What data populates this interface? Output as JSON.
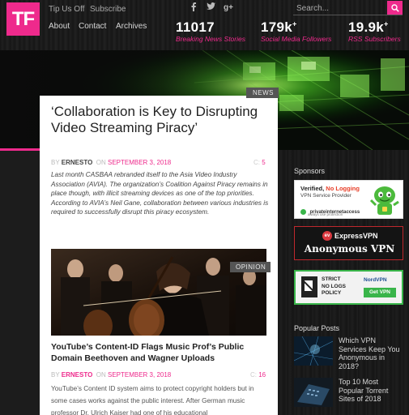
{
  "header": {
    "logo_text": "TF",
    "top_links": [
      "Tip Us Off",
      "Subscribe"
    ],
    "nav": [
      "About",
      "Contact",
      "Archives"
    ],
    "social_icons": [
      "facebook-icon",
      "twitter-icon",
      "google-plus-icon"
    ],
    "search_placeholder": "Search...",
    "stats": [
      {
        "number": "11017",
        "sup": "",
        "label": "Breaking News Stories"
      },
      {
        "number": "179k",
        "sup": "+",
        "label": "Social Media Followers"
      },
      {
        "number": "19.9k",
        "sup": "+",
        "label": "RSS Subscribers"
      }
    ],
    "accent_color": "#ee2a8c"
  },
  "feature": {
    "tag": "NEWS",
    "title": "‘Collaboration is Key to Disrupting Video Streaming Piracy’",
    "by_prefix": "BY",
    "author": "ERNESTO",
    "on_prefix": "ON",
    "date": "SEPTEMBER 3, 2018",
    "comment_prefix": "C:",
    "comments": "5",
    "excerpt": "Last month CASBAA rebranded itself to the Asia Video Industry Association (AVIA). The organization’s Coalition Against Piracy remains in place though, with illicit streaming devices as one of the top priorities. According to AVIA’s Neil Gane, collaboration between various industries is required to successfully disrupt this piracy ecosystem."
  },
  "second": {
    "tag": "OPINION",
    "title": "YouTube’s Content-ID Flags Music Prof’s Public Domain Beethoven and Wagner Uploads",
    "by_prefix": "BY",
    "author": "ERNESTO",
    "on_prefix": "ON",
    "date": "SEPTEMBER 3, 2018",
    "comment_prefix": "C:",
    "comments": "16",
    "excerpt": "YouTube’s Content ID system aims to protect copyright holders but in some cases works against the public interest. After German music professor Dr. Ulrich Kaiser had one of his educational"
  },
  "sidebar": {
    "sponsors_heading": "Sponsors",
    "ad1": {
      "line1": "Verified,",
      "line1_highlight": "No Logging",
      "line2": "VPN Service Provider",
      "brand": "privateinternetaccess",
      "brand_sub": "always use protection"
    },
    "ad2": {
      "brand": "ExpressVPN",
      "tagline": "Anonymous VPN"
    },
    "ad3": {
      "lines": [
        "STRICT",
        "NO LOGS",
        "POLICY"
      ],
      "brand": "NordVPN",
      "cta": "Get VPN"
    },
    "popular_heading": "Popular Posts",
    "popular": [
      {
        "title": "Which VPN Services Keep You Anonymous in 2018?"
      },
      {
        "title": "Top 10 Most Popular Torrent Sites of 2018"
      }
    ]
  }
}
